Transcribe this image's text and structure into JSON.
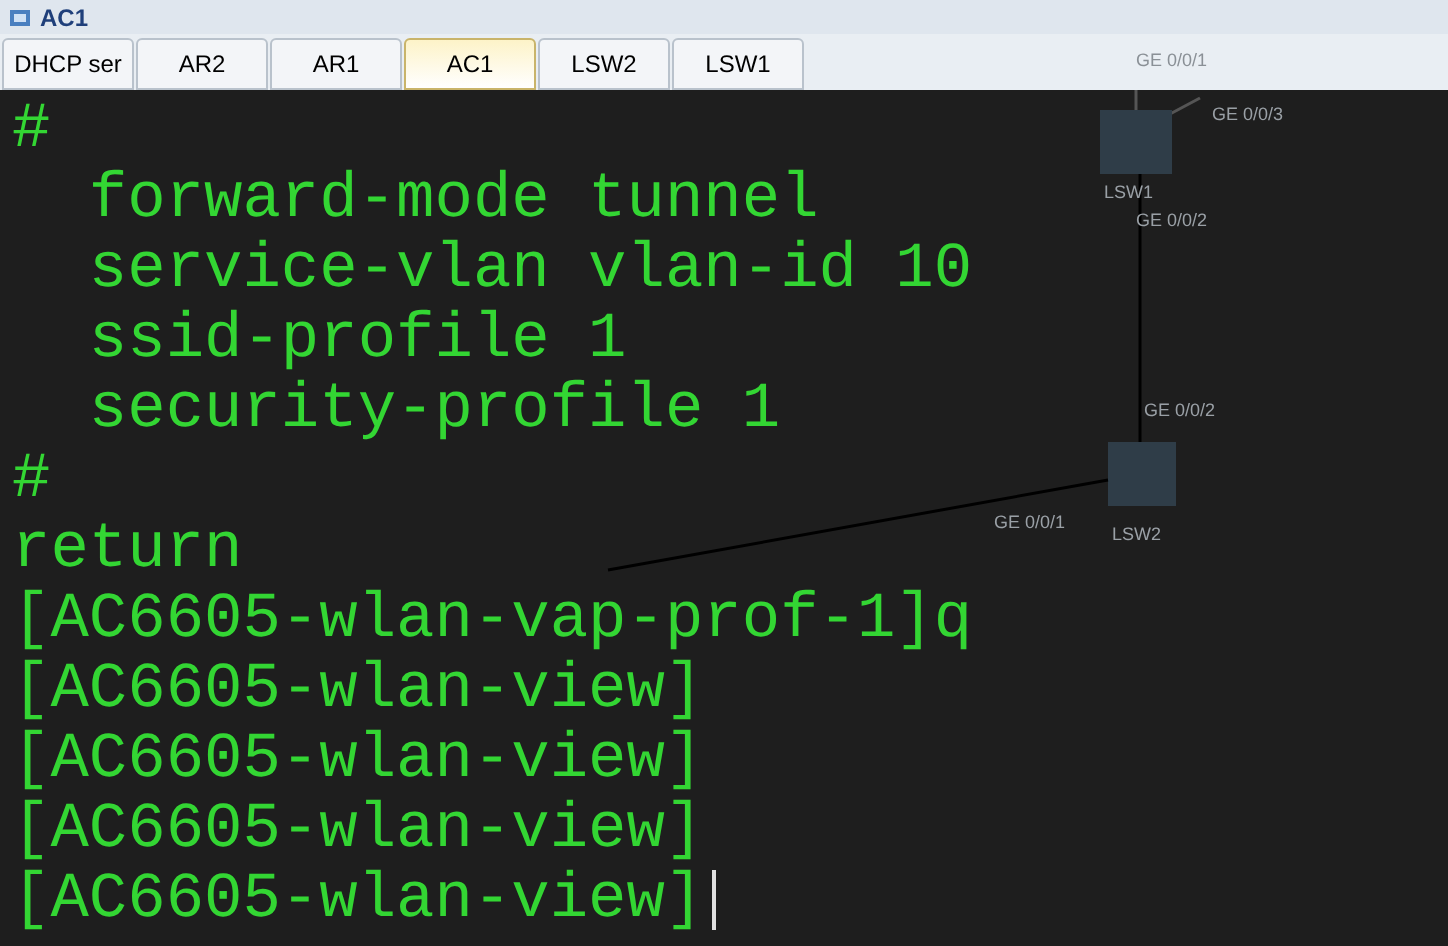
{
  "window": {
    "title": "AC1"
  },
  "tabs": [
    {
      "label": "DHCP ser",
      "selected": false
    },
    {
      "label": "AR2",
      "selected": false
    },
    {
      "label": "AR1",
      "selected": false
    },
    {
      "label": "AC1",
      "selected": true
    },
    {
      "label": "LSW2",
      "selected": false
    },
    {
      "label": "LSW1",
      "selected": false
    }
  ],
  "terminal": {
    "lines": [
      "#",
      "  forward-mode tunnel",
      "  service-vlan vlan-id 10",
      "  ssid-profile 1",
      "  security-profile 1",
      "#",
      "return",
      "[AC6605-wlan-vap-prof-1]q",
      "[AC6605-wlan-view]",
      "[AC6605-wlan-view]",
      "[AC6605-wlan-view]",
      "[AC6605-wlan-view]"
    ]
  },
  "topology": {
    "port_top": "GE 0/0/1",
    "lsw1": {
      "name": "LSW1",
      "ports": [
        "GE 0/0/3",
        "GE 0/0/2"
      ]
    },
    "lsw2": {
      "name": "LSW2",
      "ports": [
        "GE 0/0/2",
        "GE 0/0/1"
      ]
    }
  }
}
